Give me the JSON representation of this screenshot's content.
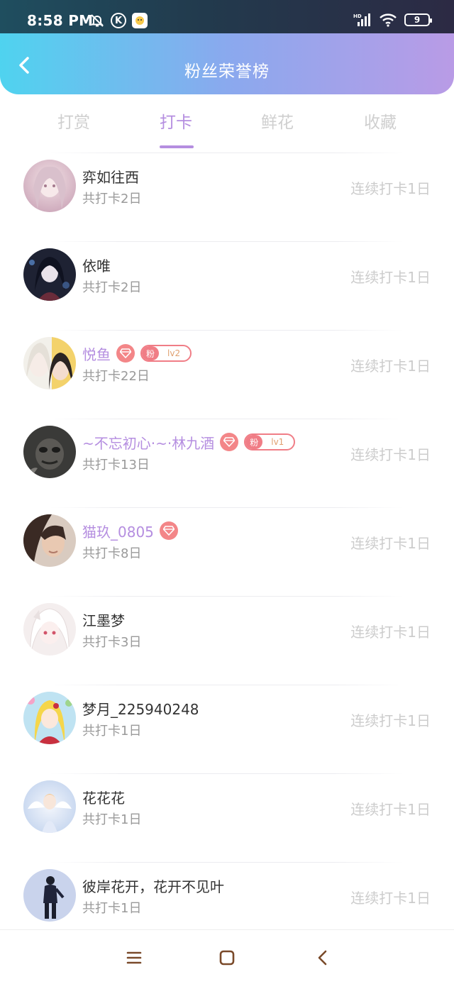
{
  "status_bar": {
    "time": "8:58 PM",
    "k_icon_text": "K",
    "battery_level": "9",
    "network": "HD",
    "icons": [
      "mute-bell-icon",
      "k-circle-icon",
      "app-notification-icon",
      "signal-icon",
      "wifi-icon",
      "battery-icon"
    ]
  },
  "header": {
    "title": "粉丝荣誉榜",
    "back_icon": "chevron-left-icon"
  },
  "tabs": [
    {
      "label": "打赏",
      "active": false
    },
    {
      "label": "打卡",
      "active": true
    },
    {
      "label": "鲜花",
      "active": false
    },
    {
      "label": "收藏",
      "active": false
    }
  ],
  "rows": [
    {
      "name": "弈如往西",
      "total": "共打卡2日",
      "streak": "连续打卡1日",
      "vip": false
    },
    {
      "name": "依唯",
      "total": "共打卡2日",
      "streak": "连续打卡1日",
      "vip": false
    },
    {
      "name": "悦鱼",
      "total": "共打卡22日",
      "streak": "连续打卡1日",
      "vip": true,
      "fan_badge": {
        "label": "粉",
        "level": "lv2"
      }
    },
    {
      "name": "~不忘初心·~·林九酒",
      "total": "共打卡13日",
      "streak": "连续打卡1日",
      "vip": true,
      "fan_badge": {
        "label": "粉",
        "level": "lv1"
      }
    },
    {
      "name": "猫玖_0805",
      "total": "共打卡8日",
      "streak": "连续打卡1日",
      "vip": true
    },
    {
      "name": "江墨梦",
      "total": "共打卡3日",
      "streak": "连续打卡1日",
      "vip": false
    },
    {
      "name": "梦月_225940248",
      "total": "共打卡1日",
      "streak": "连续打卡1日",
      "vip": false
    },
    {
      "name": "花花花",
      "total": "共打卡1日",
      "streak": "连续打卡1日",
      "vip": false
    },
    {
      "name": "彼岸花开，花开不见叶",
      "total": "共打卡1日",
      "streak": "连续打卡1日",
      "vip": false
    }
  ],
  "colors": {
    "accent": "#b58ee0",
    "gem": "#f38688",
    "fan_badge": "#f07d86",
    "header_gradient": [
      "#4fd3ef",
      "#b99be6"
    ]
  },
  "nav": {
    "icons": [
      "menu-icon",
      "home-square-icon",
      "back-triangle-icon"
    ]
  }
}
